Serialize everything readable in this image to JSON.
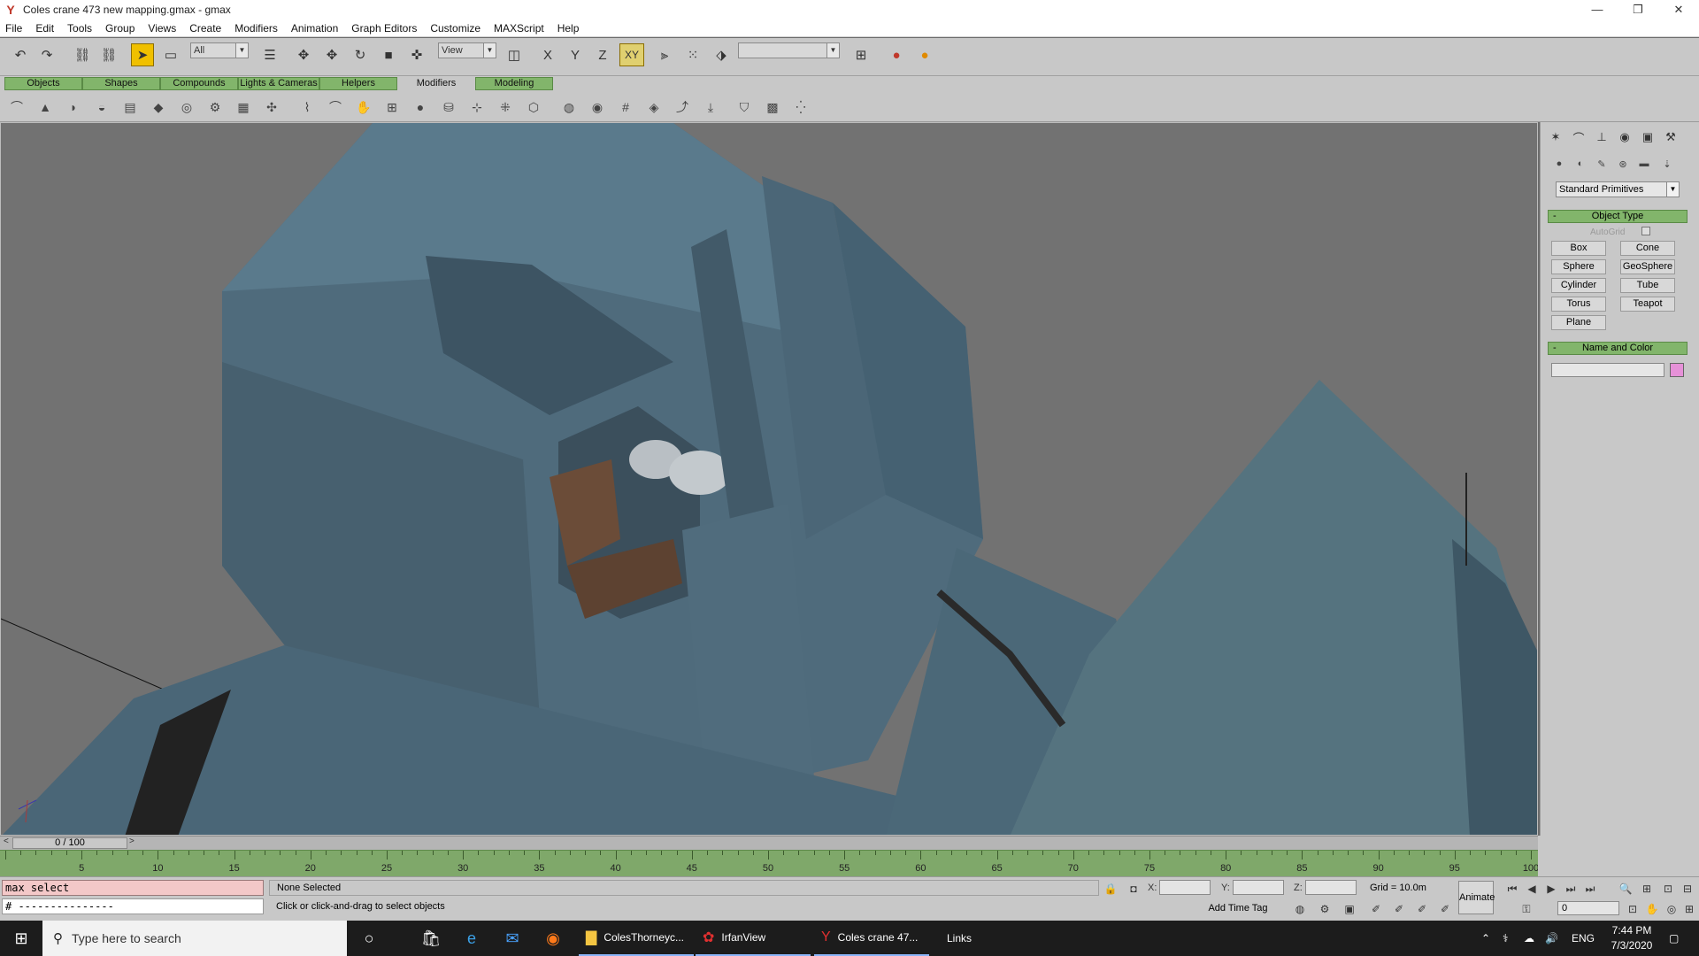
{
  "window": {
    "title": "Coles crane 473 new mapping.gmax - gmax",
    "minimize": "—",
    "restore": "❐",
    "close": "✕"
  },
  "menu": [
    "File",
    "Edit",
    "Tools",
    "Group",
    "Views",
    "Create",
    "Modifiers",
    "Animation",
    "Graph Editors",
    "Customize",
    "MAXScript",
    "Help"
  ],
  "toolbar": {
    "selection_filter": "All",
    "reference_coord": "View",
    "axis_xy": "XY",
    "named_selection": ""
  },
  "tabs": [
    "Objects",
    "Shapes",
    "Compounds",
    "Lights & Cameras",
    "Helpers",
    "Modifiers",
    "Modeling"
  ],
  "selected_tab": "Modifiers",
  "command_panel": {
    "category": "Standard Primitives",
    "object_type_title": "Object Type",
    "autogrid_label": "AutoGrid",
    "primitives": [
      "Box",
      "Cone",
      "Sphere",
      "GeoSphere",
      "Cylinder",
      "Tube",
      "Torus",
      "Teapot",
      "Plane"
    ],
    "name_color_title": "Name and Color",
    "object_name": "",
    "object_color": "#e691d8"
  },
  "timeline": {
    "frame_display": "0 / 100",
    "ticks": [
      "5",
      "10",
      "15",
      "20",
      "25",
      "30",
      "35",
      "40",
      "45",
      "50",
      "55",
      "60",
      "65",
      "70",
      "75",
      "80",
      "85",
      "90",
      "95",
      "100"
    ]
  },
  "status": {
    "listener_input": "max select",
    "listener_output": "# ---------------",
    "selection_status": "None Selected",
    "prompt": "Click or click-and-drag to select objects",
    "x_label": "X:",
    "y_label": "Y:",
    "z_label": "Z:",
    "x_value": "",
    "y_value": "",
    "z_value": "",
    "grid": "Grid = 10.0m",
    "add_time_tag": "Add Time Tag",
    "animate": "Animate",
    "current_frame": "0"
  },
  "taskbar": {
    "search_placeholder": "Type here to search",
    "tasks": [
      {
        "label": "ColesThorneyc...",
        "icon": "folder-icon"
      },
      {
        "label": "IrfanView",
        "icon": "irfanview-icon"
      },
      {
        "label": "Coles crane 47...",
        "icon": "gmax-icon"
      }
    ],
    "links": "Links",
    "language": "ENG",
    "time": "7:44 PM",
    "date": "7/3/2020"
  }
}
